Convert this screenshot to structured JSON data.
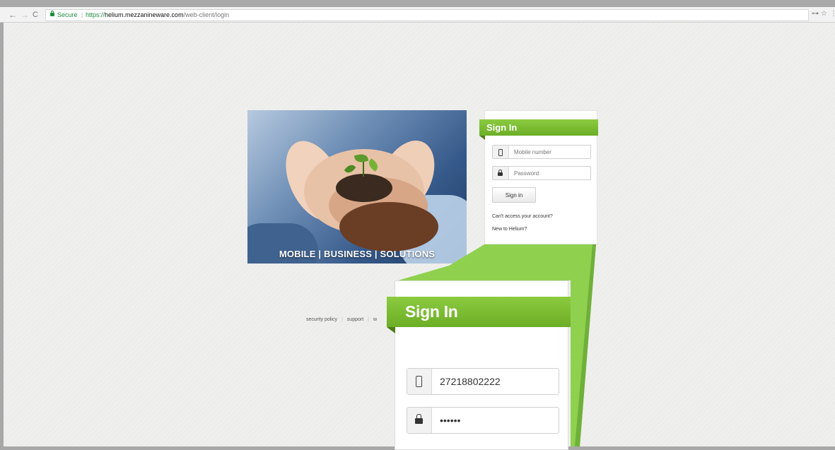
{
  "browser": {
    "back_icon": "←",
    "forward_icon": "→",
    "reload_icon": "C",
    "secure_label": "Secure",
    "url_scheme": "https://",
    "url_host": "helium.mezzanineware.com",
    "url_path": "/web-client/login",
    "key_icon": "⊶",
    "star_icon": "☆",
    "menu_icon": "⋮"
  },
  "hero": {
    "caption": "MOBILE | BUSINESS | SOLUTIONS"
  },
  "signin": {
    "title": "Sign In",
    "mobile_placeholder": "Mobile number",
    "password_placeholder": "Password",
    "button_label": "Sign in",
    "cant_access": "Can't access your account?",
    "new_to": "New to Helium?"
  },
  "footer": {
    "links": [
      "security policy",
      "support",
      "w"
    ]
  },
  "zoom": {
    "title": "Sign In",
    "mobile_value": "27218802222",
    "password_value": "••••••"
  },
  "colors": {
    "accent_green": "#7cbf35",
    "page_bg": "#efefed"
  }
}
